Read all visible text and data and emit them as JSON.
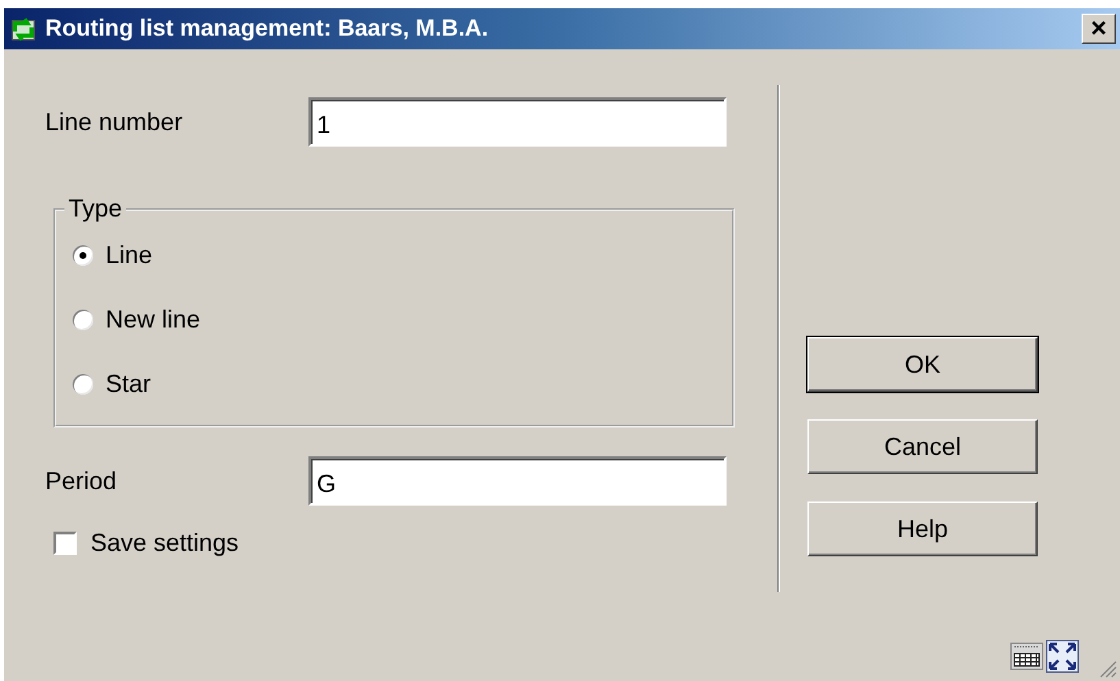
{
  "window": {
    "title": "Routing list management: Baars, M.B.A.",
    "close": "×"
  },
  "line_number": {
    "label": "Line number",
    "value": "1"
  },
  "type_group": {
    "label": "Type",
    "options": [
      {
        "label": "Line",
        "selected": true
      },
      {
        "label": "New line",
        "selected": false
      },
      {
        "label": "Star",
        "selected": false
      }
    ]
  },
  "period": {
    "label": "Period",
    "value": "G"
  },
  "save_settings": {
    "label": "Save settings",
    "checked": false
  },
  "buttons": [
    {
      "label": "OK",
      "default": true
    },
    {
      "label": "Cancel",
      "default": false
    },
    {
      "label": "Help",
      "default": false
    }
  ]
}
